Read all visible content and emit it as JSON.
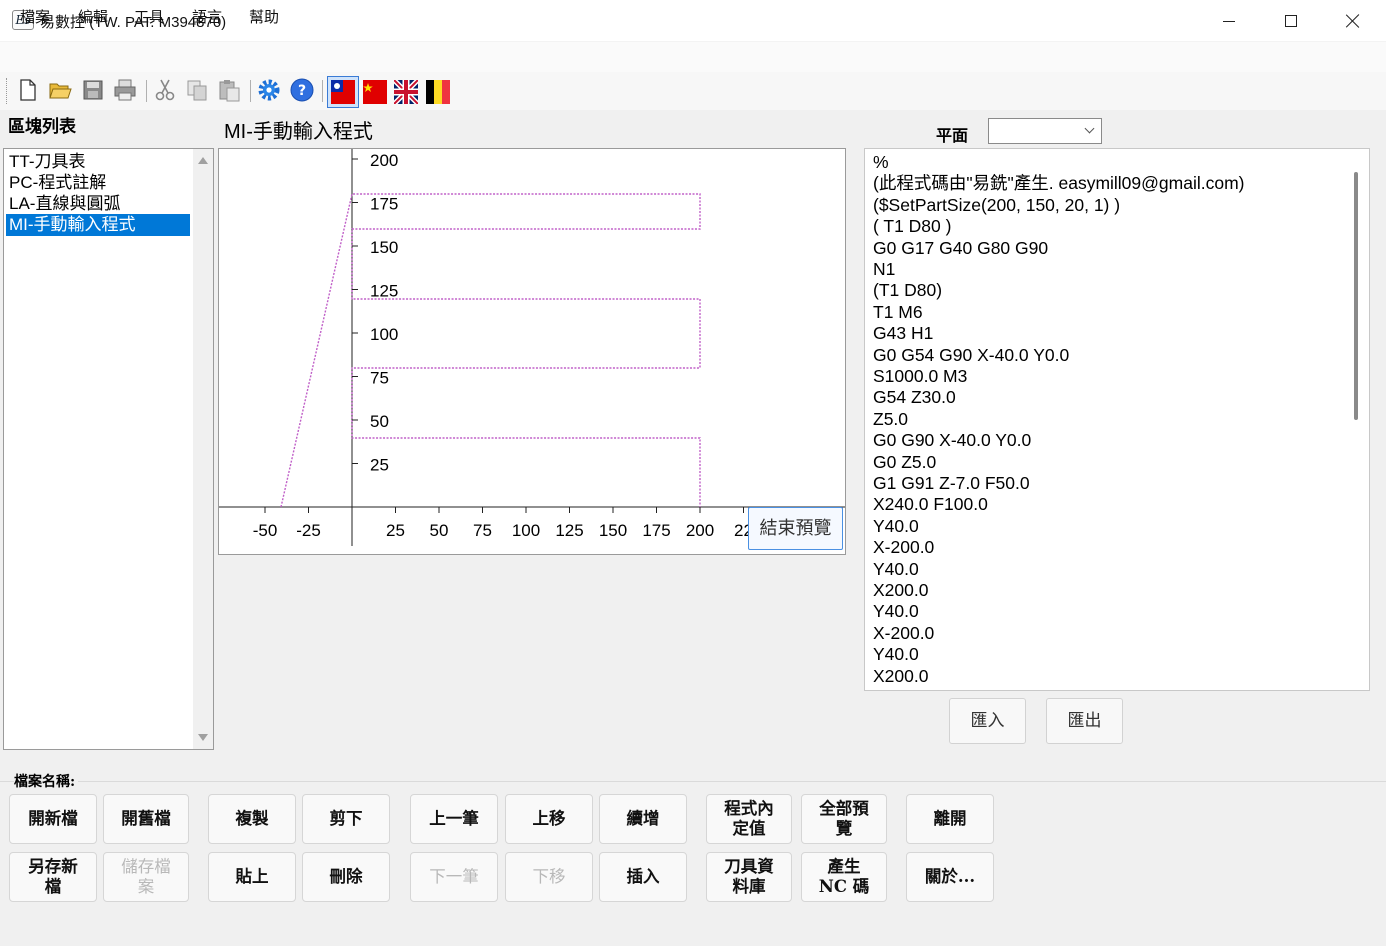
{
  "window": {
    "title": "易數控 (TW. PAT. M394870)",
    "icon": "app-logo-icon"
  },
  "menu": [
    "檔案",
    "編輯",
    "工具",
    "語言",
    "幫助"
  ],
  "toolbar": {
    "icons": [
      "new-file-icon",
      "open-folder-icon",
      "save-icon",
      "print-icon",
      "cut-icon",
      "copy-icon",
      "paste-icon",
      "settings-gear-icon",
      "help-icon",
      "flag-taiwan-icon",
      "flag-china-icon",
      "flag-uk-icon",
      "flag-belgium-icon"
    ]
  },
  "block_list": {
    "label": "區塊列表",
    "items": [
      "TT-刀具表",
      "PC-程式註解",
      "LA-直線與圓弧",
      "MI-手動輸入程式"
    ],
    "selected_index": 3
  },
  "preview": {
    "title": "MI-手動輸入程式",
    "end_button": "結束預覽",
    "x_ticks": [
      "-50",
      "-25",
      "25",
      "50",
      "75",
      "100",
      "125",
      "150",
      "175",
      "200",
      "22"
    ],
    "y_ticks": [
      "200",
      "175",
      "150",
      "125",
      "100",
      "75",
      "50",
      "25"
    ],
    "path_color": "#c060c8"
  },
  "plane": {
    "label": "平面",
    "value": ""
  },
  "nc_code": [
    "%",
    "(此程式碼由\"易銑\"產生. easymill09@gmail.com)",
    "($SetPartSize(200, 150, 20, 1) )",
    "( T1 D80 )",
    "G0 G17 G40 G80 G90",
    "N1",
    "(T1 D80)",
    "T1 M6",
    "G43 H1",
    "G0 G54 G90 X-40.0 Y0.0",
    "S1000.0 M3",
    "G54 Z30.0",
    "Z5.0",
    "G0 G90 X-40.0 Y0.0",
    "G0 Z5.0",
    "G1 G91 Z-7.0 F50.0",
    "X240.0 F100.0",
    "Y40.0",
    "X-200.0",
    "Y40.0",
    "X200.0",
    "Y40.0",
    "X-200.0",
    "Y40.0",
    "X200.0"
  ],
  "code_actions": {
    "import": "匯入",
    "export": "匯出"
  },
  "filename_label": "檔案名稱:",
  "buttons": {
    "new_file": "開新檔",
    "open_file": "開舊檔",
    "copy": "複製",
    "cut": "剪下",
    "prev": "上一筆",
    "move_up": "上移",
    "append": "續增",
    "program_define": "程式內\n定值",
    "preview_all": "全部預\n覽",
    "exit": "離開",
    "save_as": "另存新\n檔",
    "save": "儲存檔\n案",
    "paste": "貼上",
    "delete": "刪除",
    "next": "下一筆",
    "move_down": "下移",
    "insert": "插入",
    "tool_db": "刀具資\n料庫",
    "gen_nc": "產生\nNC 碼",
    "about": "關於..."
  }
}
